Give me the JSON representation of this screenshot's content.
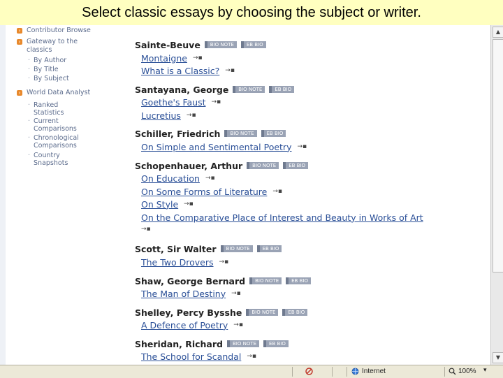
{
  "banner": {
    "title": "Select classic essays by choosing the subject or writer."
  },
  "sidebar": {
    "sections": [
      {
        "icon": "arrow-icon",
        "label": "Contributor Browse"
      },
      {
        "icon": "arrow-icon",
        "label": "Gateway to the classics"
      },
      {
        "icon": "arrow-icon",
        "label": "World Data Analyst"
      }
    ],
    "gateway_items": [
      "By Author",
      "By Title",
      "By Subject"
    ],
    "world_items": [
      "Ranked Statistics",
      "Current Comparisons",
      "Chronological Comparisons",
      "Country Snapshots"
    ]
  },
  "badges": {
    "bio_note": "BIO NOTE",
    "eb_bio": "EB BIO"
  },
  "authors": [
    {
      "name": "Sainte-Beuve",
      "essays": [
        "Montaigne",
        "What is a Classic?"
      ]
    },
    {
      "name": "Santayana, George",
      "essays": [
        "Goethe's Faust",
        "Lucretius"
      ]
    },
    {
      "name": "Schiller, Friedrich",
      "essays": [
        "On Simple and Sentimental Poetry"
      ]
    },
    {
      "name": "Schopenhauer, Arthur",
      "essays": [
        "On Education",
        "On Some Forms of Literature",
        "On Style",
        "On the Comparative Place of Interest and Beauty in Works of Art"
      ]
    },
    {
      "name": "Scott, Sir Walter",
      "essays": [
        "The Two Drovers"
      ]
    },
    {
      "name": "Shaw, George Bernard",
      "essays": [
        "The Man of Destiny"
      ]
    },
    {
      "name": "Shelley, Percy Bysshe",
      "essays": [
        "A Defence of Poetry"
      ]
    },
    {
      "name": "Sheridan, Richard",
      "essays": [
        "The School for Scandal"
      ]
    }
  ],
  "statusbar": {
    "zone": "Internet",
    "zoom": "100%"
  },
  "colors": {
    "banner_bg": "#ffffc0",
    "link": "#2a4f97",
    "accent": "#e8892c",
    "badge": "#9aa3b5"
  }
}
